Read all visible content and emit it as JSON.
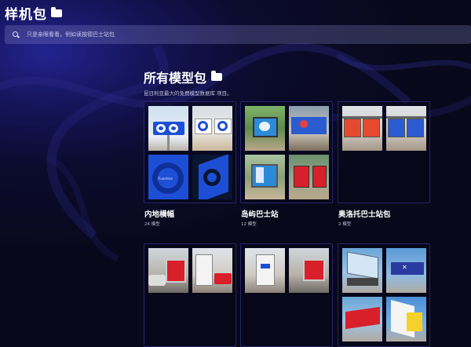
{
  "header": {
    "title": "样机包"
  },
  "search": {
    "placeholder": "只是亲眼看看，例如读按德巴士站包"
  },
  "section": {
    "title": "所有模型包",
    "subtitle": "昆日利亚最大的免费模型数据库 项目。"
  },
  "packs": [
    {
      "name": "内地横幅",
      "count": "24 模型"
    },
    {
      "name": "岛屿巴士站",
      "count": "12 模型"
    },
    {
      "name": "奥洛托巴士站包",
      "count": "2 模型"
    }
  ],
  "thumb_labels": {
    "banner": "Fluentma"
  }
}
